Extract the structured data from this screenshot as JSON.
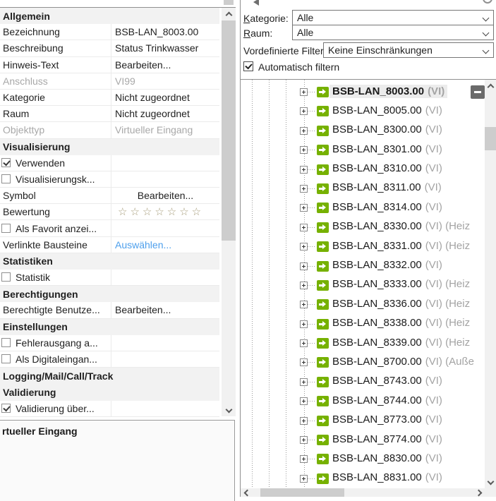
{
  "colors": {
    "accent_green": "#76B100",
    "link_blue": "#4D9FEC",
    "selection_bg": "#ECECEC",
    "star": "#A79D7B",
    "minus_badge": "#6A6A6A"
  },
  "properties_panel": {
    "rows": [
      {
        "type": "header",
        "label": "Allgemein"
      },
      {
        "type": "field",
        "label": "Bezeichnung",
        "value": "BSB-LAN_8003.00"
      },
      {
        "type": "field",
        "label": "Beschreibung",
        "value": "Status Trinkwasser"
      },
      {
        "type": "field",
        "label": "Hinweis-Text",
        "value": "Bearbeiten..."
      },
      {
        "type": "field",
        "label": "Anschluss",
        "value": "VI99",
        "disabled": true
      },
      {
        "type": "field",
        "label": "Kategorie",
        "value": "Nicht zugeordnet"
      },
      {
        "type": "field",
        "label": "Raum",
        "value": "Nicht zugeordnet"
      },
      {
        "type": "field",
        "label": "Objekttyp",
        "value": "Virtueller Eingang",
        "disabled": true
      },
      {
        "type": "header",
        "label": "Visualisierung"
      },
      {
        "type": "check",
        "label": "Verwenden",
        "checked": true
      },
      {
        "type": "check",
        "label": "Visualisierungsk...",
        "checked": false
      },
      {
        "type": "field",
        "label": "Symbol",
        "value": "Bearbeiten...",
        "align": "center"
      },
      {
        "type": "stars",
        "label": "Bewertung",
        "value": "☆☆☆☆☆☆☆"
      },
      {
        "type": "check",
        "label": "Als Favorit anzei...",
        "checked": false
      },
      {
        "type": "link",
        "label": "Verlinkte Bausteine",
        "value": "Auswählen..."
      },
      {
        "type": "header",
        "label": "Statistiken"
      },
      {
        "type": "check",
        "label": "Statistik",
        "checked": false
      },
      {
        "type": "header",
        "label": "Berechtigungen"
      },
      {
        "type": "field",
        "label": "Berechtigte Benutze...",
        "value": "Bearbeiten..."
      },
      {
        "type": "header",
        "label": "Einstellungen"
      },
      {
        "type": "check",
        "label": "Fehlerausgang a...",
        "checked": false
      },
      {
        "type": "check",
        "label": "Als Digitaleingan...",
        "checked": false
      },
      {
        "type": "header",
        "label": "Logging/Mail/Call/Track"
      },
      {
        "type": "header",
        "label": "Validierung"
      },
      {
        "type": "check",
        "label": "Validierung über...",
        "checked": true
      }
    ]
  },
  "details_panel": {
    "title": "rtueller Eingang"
  },
  "filter_bar": {
    "kategorie": {
      "mnemonic": "K",
      "label": "ategorie:",
      "value": "Alle"
    },
    "raum": {
      "mnemonic": "R",
      "label": "aum:",
      "value": "Alle"
    },
    "vordefinierte": {
      "label": "Vordefinierte Filter",
      "value": "Keine Einschränkungen"
    },
    "auto_filter": {
      "label": "Automatisch filtern",
      "checked": true
    }
  },
  "tree": {
    "items": [
      {
        "name": "BSB-LAN_8003.00",
        "suffix": "(VI)",
        "selected": true,
        "badge": "minus"
      },
      {
        "name": "BSB-LAN_8005.00",
        "suffix": "(VI)"
      },
      {
        "name": "BSB-LAN_8300.00",
        "suffix": "(VI)"
      },
      {
        "name": "BSB-LAN_8301.00",
        "suffix": "(VI)"
      },
      {
        "name": "BSB-LAN_8310.00",
        "suffix": "(VI)"
      },
      {
        "name": "BSB-LAN_8311.00",
        "suffix": "(VI)"
      },
      {
        "name": "BSB-LAN_8314.00",
        "suffix": "(VI)"
      },
      {
        "name": "BSB-LAN_8330.00",
        "suffix": "(VI) (Heiz"
      },
      {
        "name": "BSB-LAN_8331.00",
        "suffix": "(VI) (Heiz"
      },
      {
        "name": "BSB-LAN_8332.00",
        "suffix": "(VI)"
      },
      {
        "name": "BSB-LAN_8333.00",
        "suffix": "(VI) (Heiz"
      },
      {
        "name": "BSB-LAN_8336.00",
        "suffix": "(VI) (Heiz"
      },
      {
        "name": "BSB-LAN_8338.00",
        "suffix": "(VI) (Heiz"
      },
      {
        "name": "BSB-LAN_8339.00",
        "suffix": "(VI) (Heiz"
      },
      {
        "name": "BSB-LAN_8700.00",
        "suffix": "(VI) (Auße"
      },
      {
        "name": "BSB-LAN_8743.00",
        "suffix": "(VI)"
      },
      {
        "name": "BSB-LAN_8744.00",
        "suffix": "(VI)"
      },
      {
        "name": "BSB-LAN_8773.00",
        "suffix": "(VI)"
      },
      {
        "name": "BSB-LAN_8774.00",
        "suffix": "(VI)"
      },
      {
        "name": "BSB-LAN_8830.00",
        "suffix": "(VI)"
      },
      {
        "name": "BSB-LAN_8831.00",
        "suffix": "(VI)"
      }
    ]
  }
}
